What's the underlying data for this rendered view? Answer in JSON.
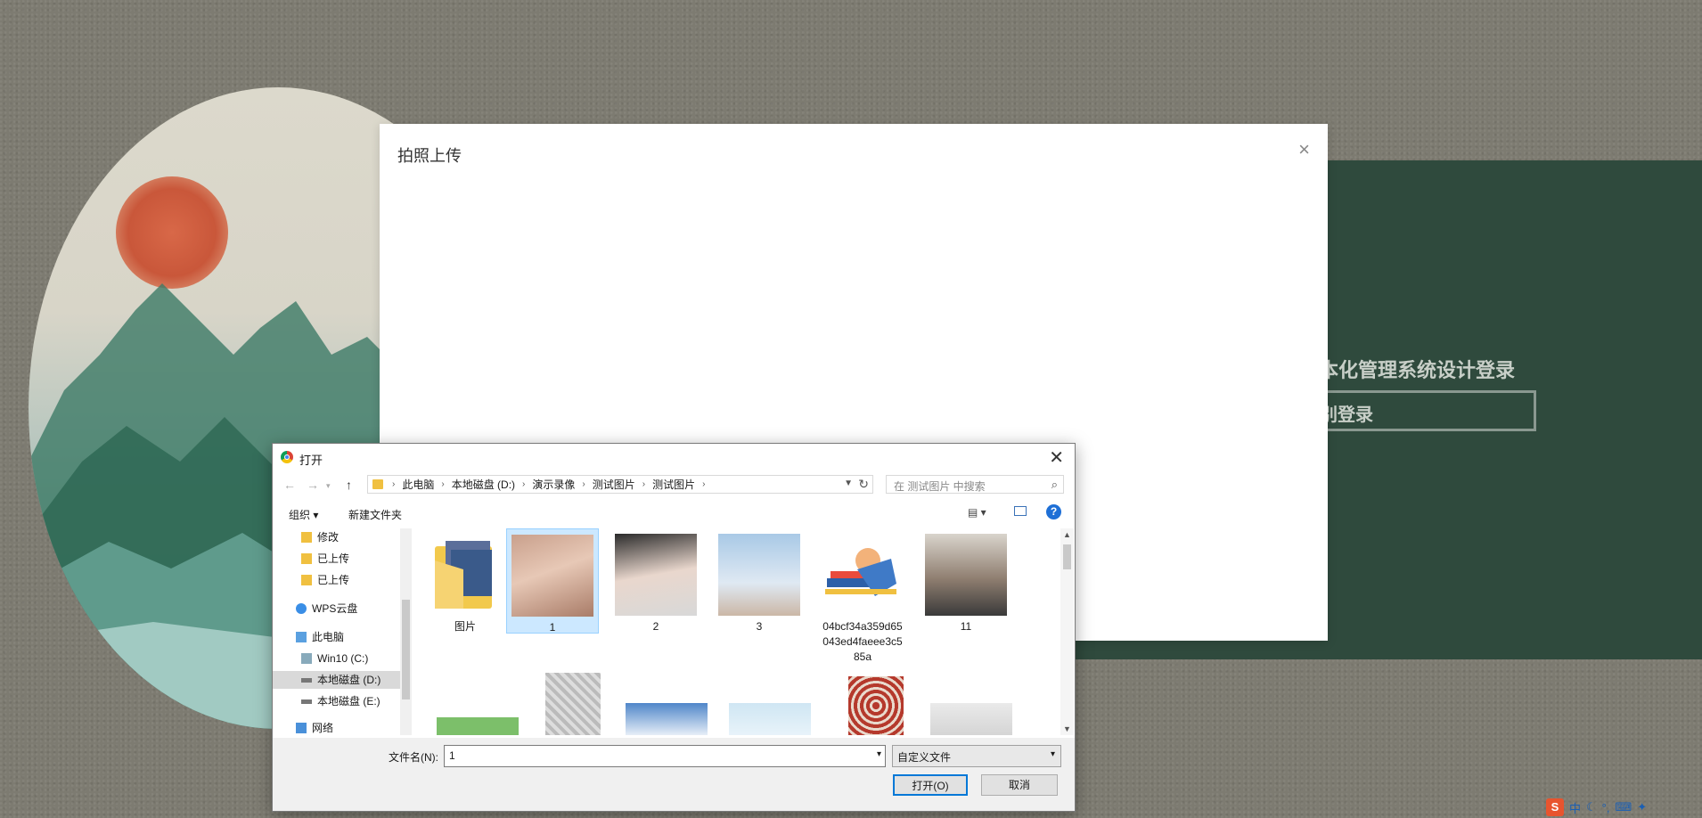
{
  "background": {
    "login_title": "本化管理系统设计登录",
    "login_button": "别登录"
  },
  "modal": {
    "title": "拍照上传",
    "close_icon": "×"
  },
  "dialog": {
    "title": "打开",
    "close_icon": "✕",
    "breadcrumb": [
      "此电脑",
      "本地磁盘 (D:)",
      "演示录像",
      "测试图片",
      "测试图片"
    ],
    "search_placeholder": "在 测试图片 中搜索",
    "toolbar": {
      "organize": "组织 ▾",
      "new_folder": "新建文件夹"
    },
    "nav_items": [
      {
        "label": "修改",
        "icon": "folder-icon"
      },
      {
        "label": "已上传",
        "icon": "folder-icon"
      },
      {
        "label": "已上传",
        "icon": "folder-icon"
      },
      {
        "label": "WPS云盘",
        "icon": "cloud-icon"
      },
      {
        "label": "此电脑",
        "icon": "computer-icon"
      },
      {
        "label": "Win10 (C:)",
        "icon": "drive-icon"
      },
      {
        "label": "本地磁盘 (D:)",
        "icon": "drive-icon",
        "selected": true
      },
      {
        "label": "本地磁盘 (E:)",
        "icon": "drive-icon"
      },
      {
        "label": "网络",
        "icon": "network-icon"
      }
    ],
    "files": [
      {
        "name": "图片",
        "type": "folder"
      },
      {
        "name": "1",
        "type": "image",
        "selected": true
      },
      {
        "name": "2",
        "type": "image"
      },
      {
        "name": "3",
        "type": "image"
      },
      {
        "name": "04bcf34a359d65043ed4faeee3c585a",
        "type": "image"
      },
      {
        "name": "11",
        "type": "image"
      }
    ],
    "filename_label": "文件名(N):",
    "filename_value": "1",
    "filetype_value": "自定义文件",
    "open_button": "打开(O)",
    "cancel_button": "取消"
  },
  "ime": {
    "logo": "S",
    "mode": "中"
  }
}
